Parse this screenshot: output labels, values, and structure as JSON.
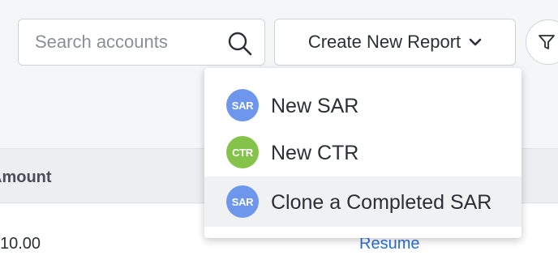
{
  "search": {
    "placeholder": "Search accounts",
    "icon": "search-icon"
  },
  "create_button": {
    "label": "Create New Report",
    "icon": "chevron-down-icon"
  },
  "filter_button": {
    "icon": "filter-icon"
  },
  "table": {
    "headers": {
      "amount": "Amount"
    },
    "rows": [
      {
        "amount": "10.00",
        "action": "Resume"
      }
    ]
  },
  "menu": {
    "items": [
      {
        "badge": "SAR",
        "badge_color": "#6d96ec",
        "label": "New SAR"
      },
      {
        "badge": "CTR",
        "badge_color": "#86c34a",
        "label": "New CTR"
      },
      {
        "badge": "SAR",
        "badge_color": "#6d96ec",
        "label": "Clone a Completed SAR"
      }
    ]
  },
  "colors": {
    "link": "#2d6fd4",
    "background": "#f5f6f8",
    "highlight": "#f0f1f3"
  }
}
